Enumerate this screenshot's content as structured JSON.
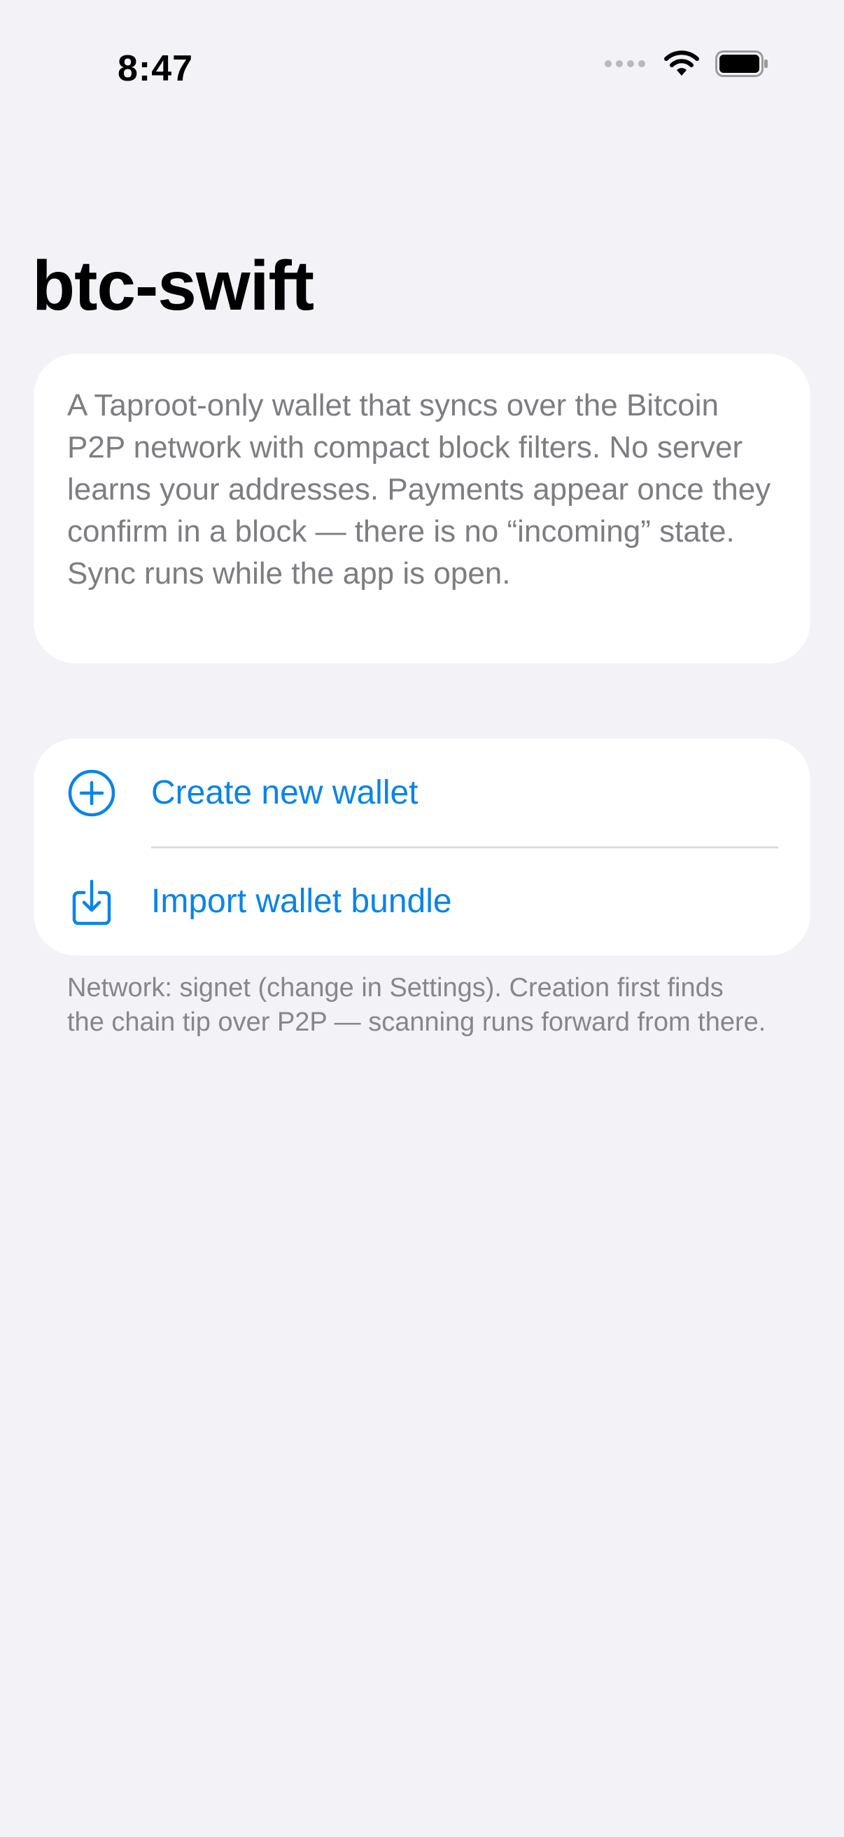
{
  "status_bar": {
    "time": "8:47"
  },
  "title": "btc-swift",
  "intro": {
    "text": "A Taproot-only wallet that syncs over the Bitcoin P2P network with compact block filters. No server learns your addresses. Payments appear once they confirm in a block — there is no “incoming” state. Sync runs while the app is open."
  },
  "actions": {
    "create": {
      "label": "Create new wallet",
      "icon": "plus-circle-icon"
    },
    "import": {
      "label": "Import wallet bundle",
      "icon": "tray-arrow-down-icon"
    }
  },
  "footnote": "Network: signet (change in Settings). Creation first finds the chain tip over P2P — scanning runs forward from there.",
  "colors": {
    "background": "#f2f2f7",
    "card": "#ffffff",
    "accent": "#0a84e6",
    "secondary_text": "#7d7d82"
  }
}
